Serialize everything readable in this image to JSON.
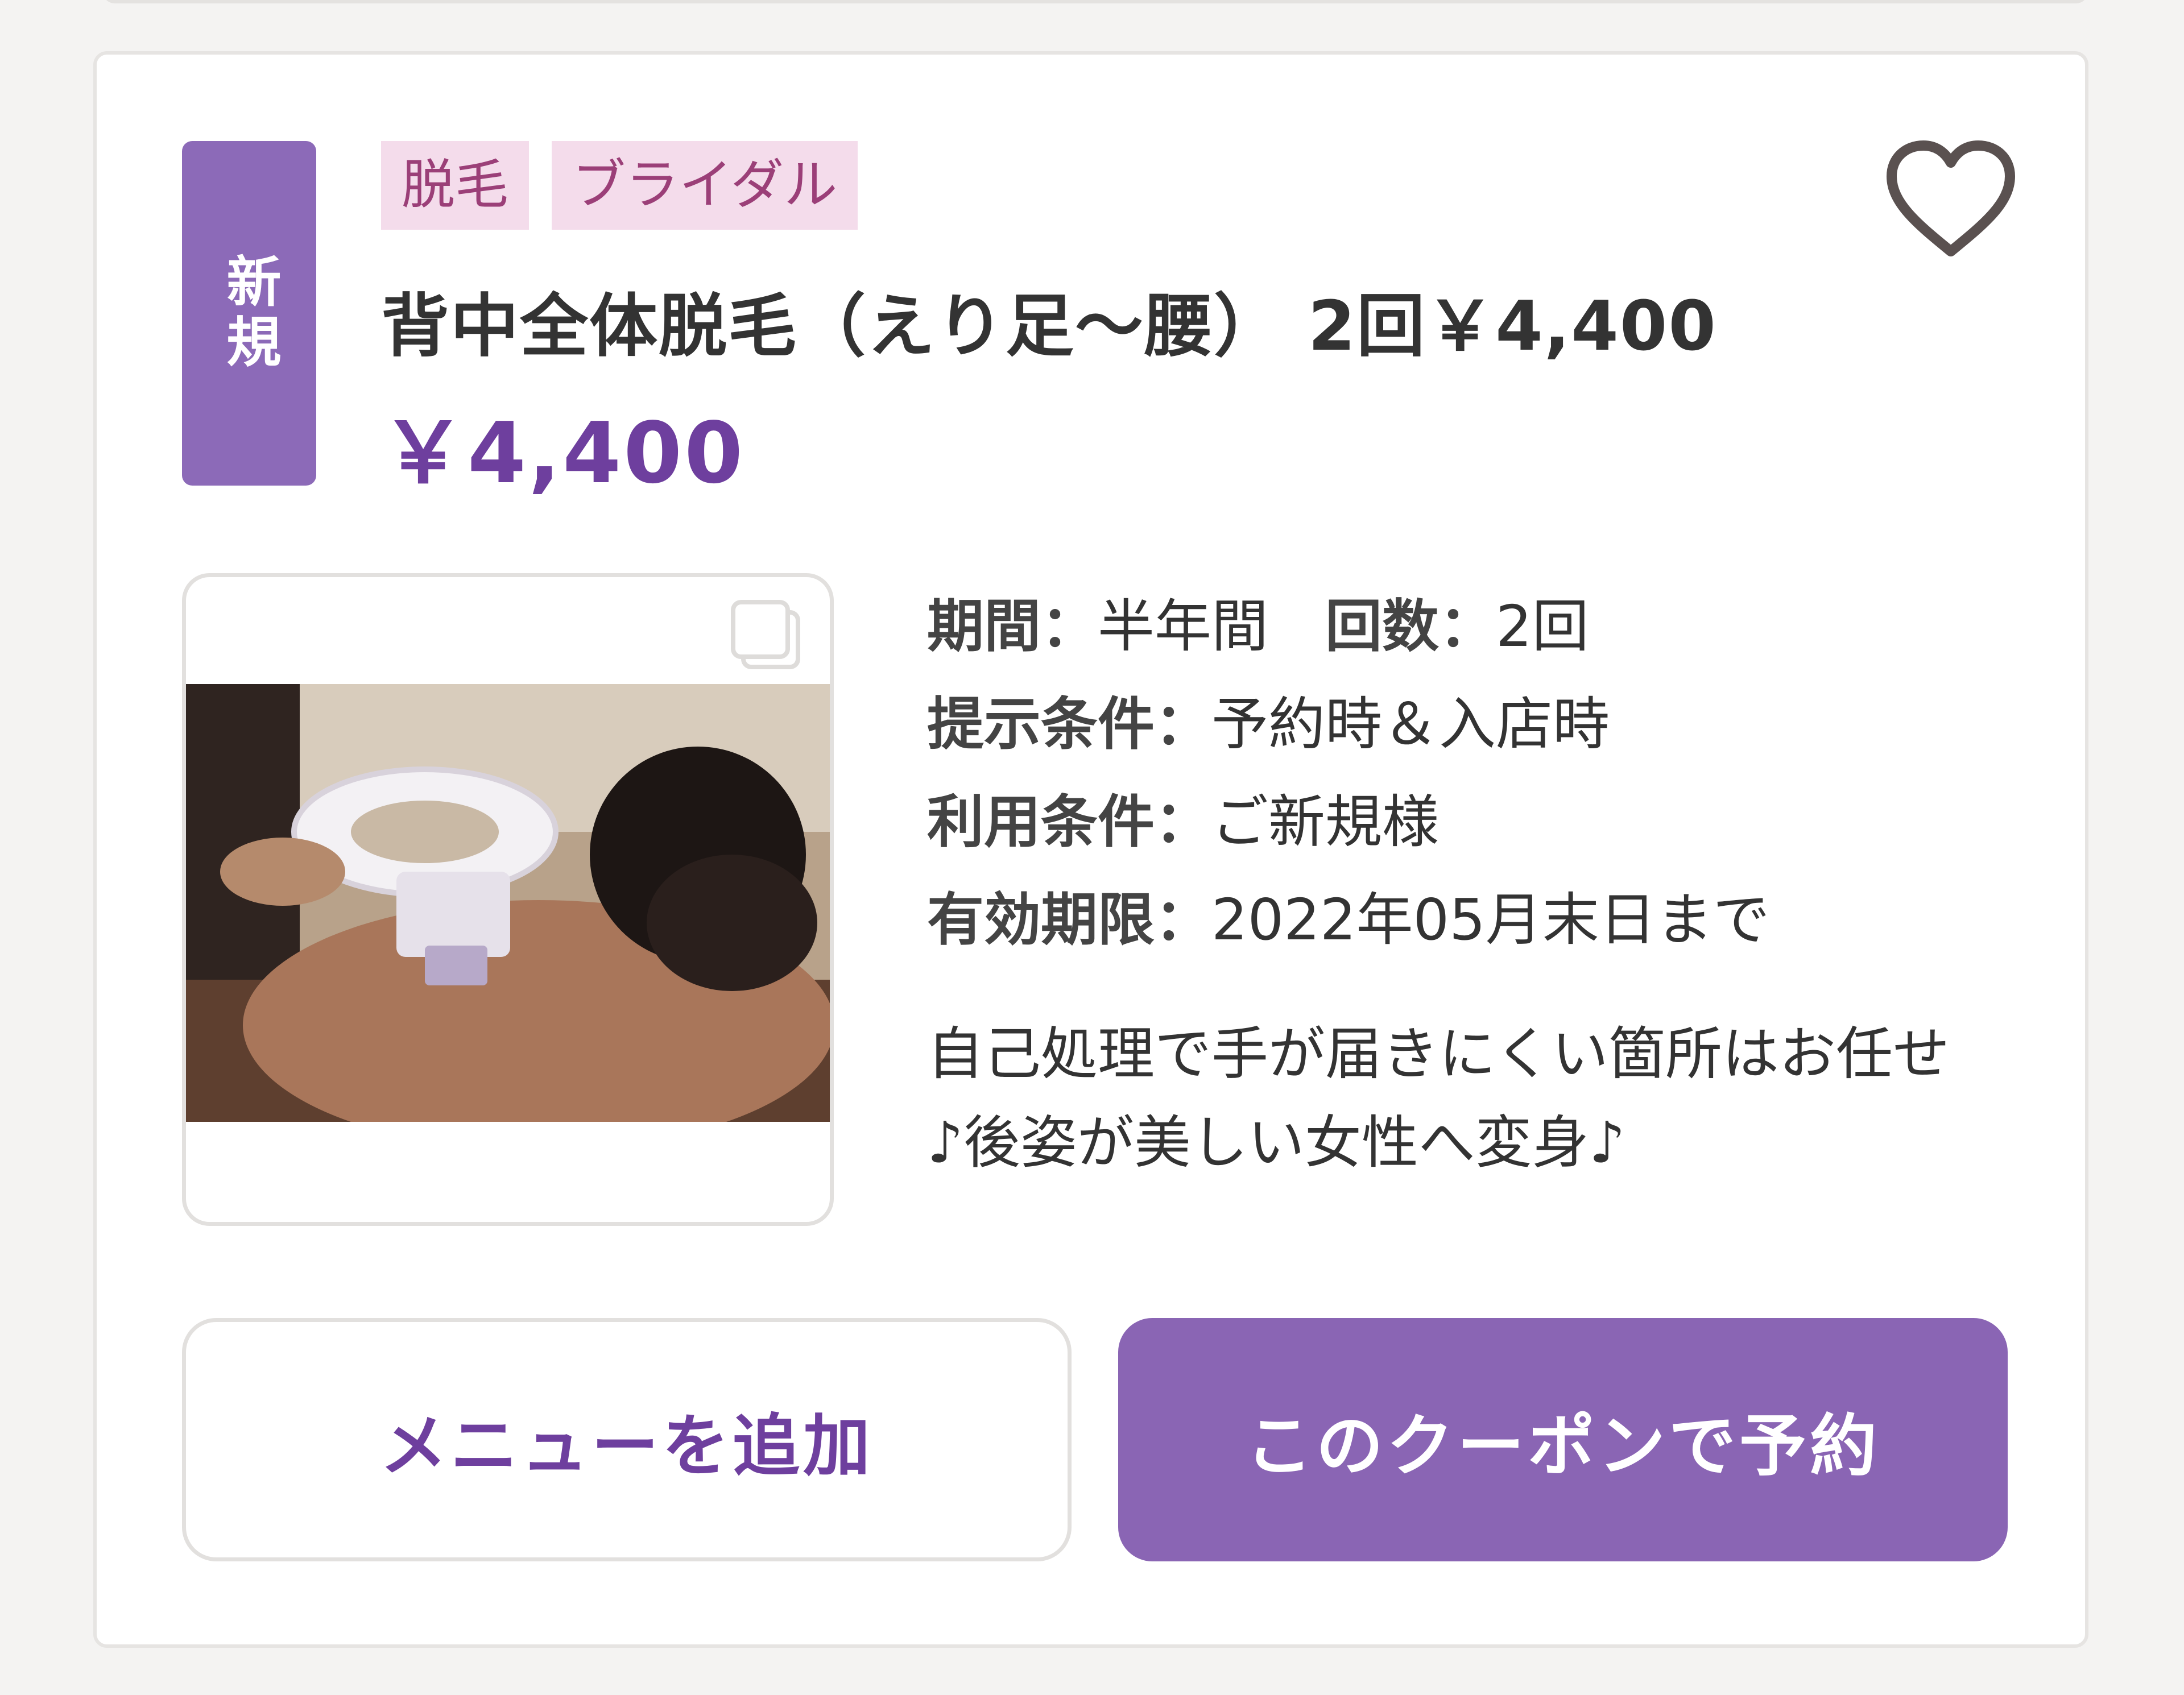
{
  "card": {
    "badge": "新規",
    "tags": [
      "脱毛",
      "ブライダル"
    ],
    "favorite_icon": "heart-outline-icon",
    "title": "背中全体脱毛（えり足〜腰） 2回￥4,400",
    "price": "￥4,400",
    "details": [
      {
        "key": "期間：",
        "value": "半年間",
        "key2": "回数：",
        "value2": "2回"
      },
      {
        "key": "提示条件：",
        "value": "予約時＆入店時"
      },
      {
        "key": "利用条件：",
        "value": "ご新規様"
      },
      {
        "key": "有効期限：",
        "value": "2022年05月末日まで"
      }
    ],
    "description_line1": "自己処理で手が届きにくい箇所はお任せ",
    "description_line2": "♪後姿が美しい女性へ変身♪",
    "buttons": {
      "add_menu": "メニューを追加",
      "reserve": "このクーポンで予約"
    },
    "colors": {
      "accent": "#8a65b4",
      "price": "#6e3f9e",
      "tag_bg": "#f4dceb",
      "tag_text": "#9b3f78"
    }
  }
}
